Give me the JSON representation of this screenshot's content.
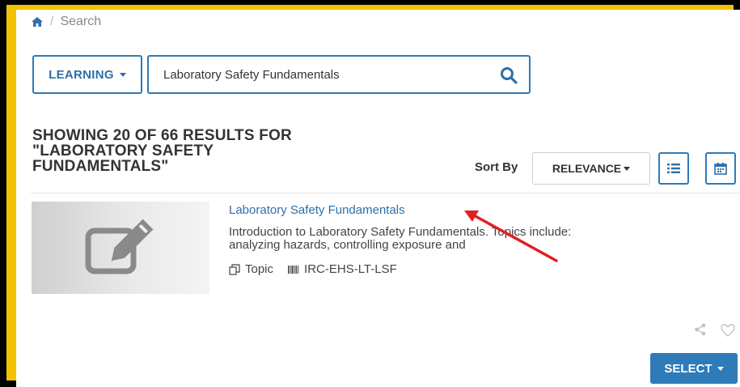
{
  "breadcrumb": {
    "separator": "/",
    "current": "Search",
    "home_icon": "home-icon"
  },
  "search": {
    "scope_label": "LEARNING",
    "query": "Laboratory Safety Fundamentals",
    "icon": "search-icon"
  },
  "results": {
    "heading": "SHOWING 20 OF 66 RESULTS FOR \"LABORATORY SAFETY FUNDAMENTALS\"",
    "sort_label": "Sort By",
    "sort_value": "RELEVANCE",
    "view_icons": [
      "list-view-icon",
      "calendar-view-icon"
    ]
  },
  "item": {
    "title": "Laboratory Safety Fundamentals",
    "description": "Introduction to Laboratory Safety Fundamentals. Topics include: analyzing hazards, controlling exposure and",
    "type": "Topic",
    "code": "IRC-EHS-LT-LSF",
    "select_label": "SELECT"
  },
  "colors": {
    "accent": "#2f7ab8",
    "frame": "#f2c200",
    "annotation_arrow": "#e02020"
  }
}
